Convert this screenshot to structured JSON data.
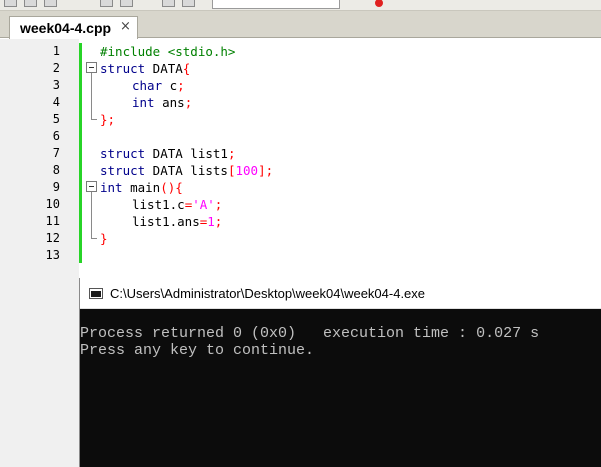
{
  "tab": {
    "filename": "week04-4.cpp",
    "close_glyph": "×"
  },
  "editor": {
    "line_numbers": [
      "1",
      "2",
      "3",
      "4",
      "5",
      "6",
      "7",
      "8",
      "9",
      "10",
      "11",
      "12",
      "13"
    ],
    "code": {
      "l1": {
        "include": "#include <stdio.h>"
      },
      "l2": {
        "kw": "struct",
        "name": " DATA",
        "brace": "{"
      },
      "l3": {
        "type": "char",
        "rest": " c",
        "semi": ";"
      },
      "l4": {
        "type": "int",
        "rest": " ans",
        "semi": ";"
      },
      "l5": {
        "close": "};"
      },
      "l7": {
        "kw": "struct",
        "rest": " DATA list1",
        "semi": ";"
      },
      "l8": {
        "kw": "struct",
        "rest": " DATA lists",
        "lb": "[",
        "num": "100",
        "rb": "];"
      },
      "l9": {
        "type": "int",
        "rest": " main",
        "paren": "(){"
      },
      "l10": {
        "lhs": "list1.c",
        "eq": "=",
        "str": "'A'",
        "semi": ";"
      },
      "l11": {
        "lhs": "list1.ans",
        "eq": "=",
        "num": "1",
        "semi": ";"
      },
      "l12": {
        "close": "}"
      }
    }
  },
  "console": {
    "title": "C:\\Users\\Administrator\\Desktop\\week04\\week04-4.exe",
    "line1": "Process returned 0 (0x0)   execution time : 0.027 s",
    "line2": "Press any key to continue."
  },
  "colors": {
    "keyword": "#00008b",
    "preprocessor": "#008000",
    "operator": "#ff0000",
    "number": "#ff00ff",
    "string": "#0000ff",
    "change_bar": "#27d427",
    "console_bg": "#0c0c0c",
    "console_text": "#c0c0c0"
  },
  "icons": [
    "close-icon",
    "fold-icon",
    "console-window-icon",
    "toolbar-icon"
  ]
}
